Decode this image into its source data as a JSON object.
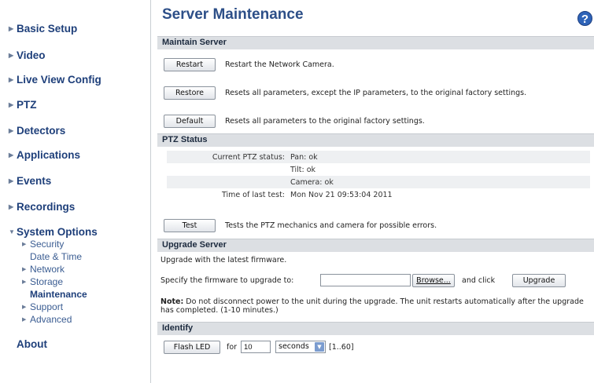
{
  "sidebar": {
    "items": [
      {
        "label": "Basic Setup"
      },
      {
        "label": "Video"
      },
      {
        "label": "Live View Config"
      },
      {
        "label": "PTZ"
      },
      {
        "label": "Detectors"
      },
      {
        "label": "Applications"
      },
      {
        "label": "Events"
      },
      {
        "label": "Recordings"
      },
      {
        "label": "System Options"
      }
    ],
    "sub_items": [
      {
        "label": "Security"
      },
      {
        "label": "Date & Time"
      },
      {
        "label": "Network"
      },
      {
        "label": "Storage"
      },
      {
        "label": "Maintenance"
      },
      {
        "label": "Support"
      },
      {
        "label": "Advanced"
      }
    ],
    "about": "About"
  },
  "page": {
    "title": "Server Maintenance",
    "help_icon_glyph": "?"
  },
  "maintain": {
    "header": "Maintain Server",
    "restart_label": "Restart",
    "restart_desc": "Restart the Network Camera.",
    "restore_label": "Restore",
    "restore_desc": "Resets all parameters, except the IP parameters, to the original factory settings.",
    "default_label": "Default",
    "default_desc": "Resets all parameters to the original factory settings."
  },
  "ptz": {
    "header": "PTZ Status",
    "current_label": "Current PTZ status:",
    "pan": "Pan: ok",
    "tilt": "Tilt: ok",
    "camera": "Camera: ok",
    "last_test_label": "Time of last test:",
    "last_test_value": "Mon Nov 21 09:53:04 2011",
    "test_label": "Test",
    "test_desc": "Tests the PTZ mechanics and camera for possible errors."
  },
  "upgrade": {
    "header": "Upgrade Server",
    "intro": "Upgrade with the latest firmware.",
    "specify_label": "Specify the firmware to upgrade to:",
    "file_value": "",
    "browse_label": "Browse...",
    "and_click": "and click",
    "upgrade_label": "Upgrade",
    "note_bold": "Note:",
    "note_text": " Do not disconnect power to the unit during the upgrade. The unit restarts automatically after the upgrade has completed. (1-10 minutes.)"
  },
  "identify": {
    "header": "Identify",
    "flash_label": "Flash LED",
    "for_label": "for",
    "duration_value": "10",
    "unit_selected": "seconds",
    "range": "[1..60]"
  },
  "colors": {
    "nav_text": "#1e3f7a",
    "title_text": "#2d4f88",
    "section_bar": "#dcdfe3",
    "help_icon": "#2e63b8"
  }
}
